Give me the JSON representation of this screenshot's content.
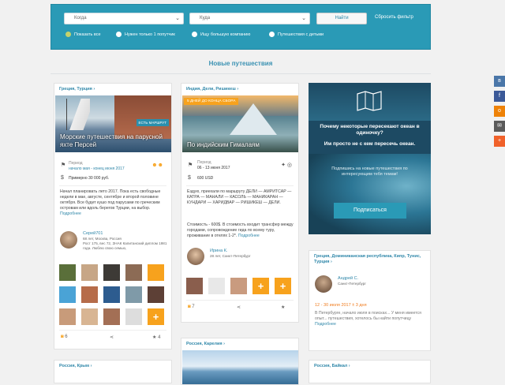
{
  "filter": {
    "from_value": "Когда",
    "to_value": "Куда",
    "search_label": "Найти",
    "reset_label": "Сбросить фильтр",
    "radios": [
      "Показать все",
      "Нужен только 1 попутчик",
      "Ищу большую компанию",
      "Путешествия с детьми"
    ]
  },
  "section_title": "Новые путешествия",
  "cards": [
    {
      "location": "Греция, Турция",
      "title": "Морские путешествия на парусной яхте Персей",
      "badge": "ЕСТЬ МАРШРУТ",
      "period_label": "Период",
      "period": "начало мая - конец июня 2017",
      "budget": "Примерно 30 000 руб.",
      "text": "Начал планировать лето 2017. Пока есть свободные недели в мае, августе, сентябре и второй половине октября. Все будет кушо под парусами по греческим островам или вдоль берегов Турции, на выбор.",
      "more": "Подробнее",
      "author": "Серей701",
      "author_meta": "68 лет, Москва, Россия",
      "author_details": "Рост 175, вес 72, ЗНАК Капитанский диплом 1981 года. Люблю свою семью,",
      "footer_count": "6",
      "like_count": "4"
    },
    {
      "location": "Индия, Дели, Ришикеш",
      "days_badge": "5 ДНЕЙ ДО КОНЦА СБОРА",
      "title": "По индийским Гималаям",
      "period_label": "Период",
      "period": "06 - 13 июня 2017",
      "budget": "600 USD",
      "text": "Ездую, приехали по маршруту ДЕЛИ — АМРИТСАР — КАТРА — МАНАЛИ — КАСОЛЬ — МАНИКАРАН — КУНДАРИ — ХАРИДВАР — РИШИКЕШ — ДЕЛИ.",
      "text2": "Стоимость - 600$. В стоимость входит трансфер между городами, сопровождение гида по всему туру, проживание в отелях 1-2*.",
      "more": "Подробнее",
      "author": "Ирина К.",
      "author_meta": "28 лет, Санкт-Петербург",
      "footer_count": "7"
    },
    {
      "location": "Греция, Доминиканская республика, Кипр, Тунис, Турция",
      "author": "Андрей С.",
      "author_meta": "Санкт-Петербург",
      "dates": "12 - 30 июля 2017 ± 3 дня",
      "text": "В Петербурге, начало июля в поисках... У меня имеется опыт... путешествия, хотелось бы найти попутчицу",
      "more": "Подробнее"
    },
    {
      "location": "Россия, Карелия"
    },
    {
      "location": "Россия, Крым"
    },
    {
      "location": "Россия, Байкал"
    }
  ],
  "ad": {
    "title": "Почему некоторые пересекают океан в одиночку?",
    "subtitle": "Им просто не с кем пересечь океан.",
    "body": "Подпишись на новые путешествия по интересующим тебя темам!",
    "button": "Подписаться"
  },
  "share_colors": [
    "#4a76a8",
    "#3b5998",
    "#ee8208",
    "#5a5a5a",
    "#f0612a"
  ],
  "share_icons": [
    "vk-icon",
    "facebook-icon",
    "odnoklassniki-icon",
    "mail-icon",
    "plus-icon"
  ]
}
